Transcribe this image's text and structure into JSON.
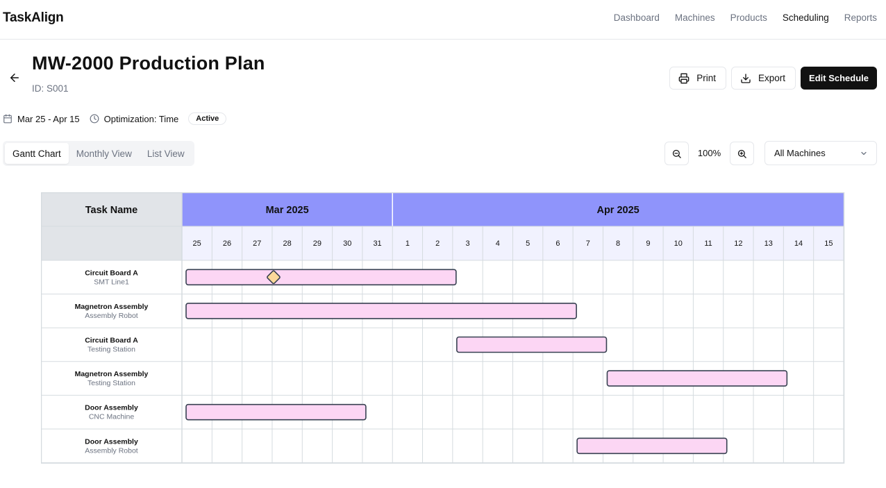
{
  "app": {
    "brand": "TaskAlign"
  },
  "nav": {
    "items": [
      {
        "label": "Dashboard",
        "active": false
      },
      {
        "label": "Machines",
        "active": false
      },
      {
        "label": "Products",
        "active": false
      },
      {
        "label": "Scheduling",
        "active": true
      },
      {
        "label": "Reports",
        "active": false
      }
    ]
  },
  "header": {
    "back_icon": "arrow-left-icon",
    "title": "MW-2000 Production Plan",
    "id_text": "ID: S001"
  },
  "actions": {
    "print_label": "Print",
    "print_icon": "printer-icon",
    "export_label": "Export",
    "export_icon": "download-icon",
    "edit_label": "Edit Schedule"
  },
  "meta": {
    "date_range": "Mar 25 - Apr 15",
    "date_icon": "calendar-icon",
    "optimization": "Optimization: Time",
    "optimization_icon": "clock-icon",
    "status": "Active"
  },
  "tabs": [
    {
      "label": "Gantt Chart",
      "active": true
    },
    {
      "label": "Monthly View",
      "active": false
    },
    {
      "label": "List View",
      "active": false
    }
  ],
  "zoom": {
    "level": "100%",
    "out_icon": "zoom-out-icon",
    "in_icon": "zoom-in-icon"
  },
  "machine_filter": {
    "selected": "All Machines",
    "icon": "chevron-down-icon"
  },
  "gantt": {
    "task_header": "Task Name",
    "months": [
      {
        "label": "Mar 2025",
        "days": [
          "25",
          "26",
          "27",
          "28",
          "29",
          "30",
          "31"
        ]
      },
      {
        "label": "Apr 2025",
        "days": [
          "1",
          "2",
          "3",
          "4",
          "5",
          "6",
          "7",
          "8",
          "9",
          "10",
          "11",
          "12",
          "13",
          "14",
          "15"
        ]
      }
    ],
    "colors": {
      "month_bg": "#8f94fb",
      "day_bg": "#f1f2fe",
      "header_left_bg": "#e1e4e8",
      "bar_fill": "#fcd6f4",
      "bar_stroke": "#374151",
      "milestone_fill": "#fcd99a",
      "grid": "#d5dbdf"
    },
    "rows": [
      {
        "task": "Circuit Board A",
        "machine": "SMT Line1",
        "start": "2025-03-25",
        "end": "2025-04-03",
        "milestone": "2025-03-28"
      },
      {
        "task": "Magnetron Assembly",
        "machine": "Assembly Robot",
        "start": "2025-03-25",
        "end": "2025-04-07"
      },
      {
        "task": "Circuit Board A",
        "machine": "Testing Station",
        "start": "2025-04-03",
        "end": "2025-04-08"
      },
      {
        "task": "Magnetron Assembly",
        "machine": "Testing Station",
        "start": "2025-04-08",
        "end": "2025-04-14"
      },
      {
        "task": "Door Assembly",
        "machine": "CNC Machine",
        "start": "2025-03-25",
        "end": "2025-03-31"
      },
      {
        "task": "Door Assembly",
        "machine": "Assembly Robot",
        "start": "2025-04-07",
        "end": "2025-04-12"
      }
    ]
  }
}
